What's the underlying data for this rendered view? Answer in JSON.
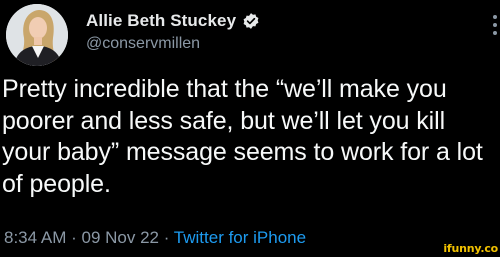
{
  "tweet": {
    "display_name": "Allie Beth Stuckey",
    "handle": "@conservmillen",
    "verified": true,
    "text": "Pretty incredible that the “we’ll make you poorer and less safe, but we’ll let you kill your baby” message seems to work for a lot of people.",
    "time": "8:34 AM",
    "separator": " · ",
    "date": "09 Nov 22",
    "source": "Twitter for iPhone"
  },
  "icons": {
    "avatar": "profile-photo",
    "verified": "verified-badge-icon",
    "more": "more-options-icon"
  },
  "colors": {
    "background": "#000000",
    "text": "#e7e9ea",
    "secondary": "#8b98a5",
    "link": "#1d9bf0",
    "verified": "#1d9bf0",
    "watermark": "#f2c200"
  },
  "watermark": {
    "text": "ifunny.co"
  }
}
